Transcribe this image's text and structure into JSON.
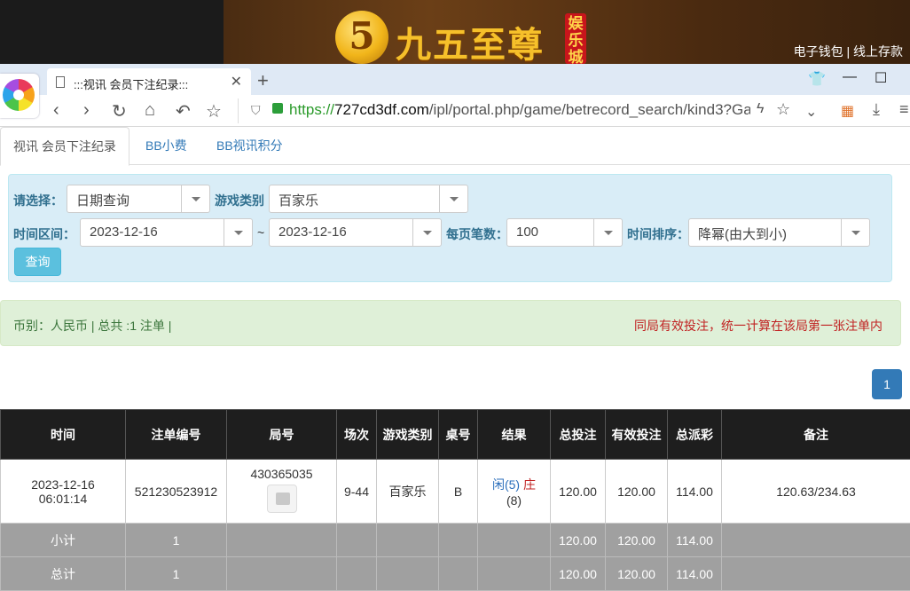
{
  "banner": {
    "logo_glyph": "5",
    "brand_name": "九五至尊",
    "brand_tag": "娱乐城",
    "links": "电子钱包 | 线上存款"
  },
  "browser": {
    "tab_title": ":::视讯 会员下注纪录:::",
    "url_scheme": "https://",
    "url_host": "727cd3df.com",
    "url_path": "/ipl/portal.php/game/betrecord_search/kind3?Ga"
  },
  "page_tabs": [
    {
      "label": "视讯 会员下注纪录",
      "active": true
    },
    {
      "label": "BB小费",
      "active": false
    },
    {
      "label": "BB视讯积分",
      "active": false
    }
  ],
  "filter": {
    "select_label": "请选择：",
    "select_value": "日期查询",
    "game_type_label": "游戏类别",
    "game_type_value": "百家乐",
    "range_label": "时间区间：",
    "date_from": "2023-12-16",
    "range_sep": "~",
    "date_to": "2023-12-16",
    "per_page_label": "每页笔数：",
    "per_page_value": "100",
    "sort_label": "时间排序：",
    "sort_value": "降幂(由大到小)",
    "query_button": "查询"
  },
  "summary": {
    "left": "币别：人民币 | 总共 :1 注单 |",
    "right": "同局有效投注，统一计算在该局第一张注单内"
  },
  "pagination": {
    "current": "1"
  },
  "table": {
    "headers": [
      "时间",
      "注单编号",
      "局号",
      "场次",
      "游戏类别",
      "桌号",
      "结果",
      "总投注",
      "有效投注",
      "总派彩",
      "备注"
    ],
    "row": {
      "date": "2023-12-16",
      "time": "06:01:14",
      "bet_no": "521230523912",
      "round_no": "430365035",
      "session": "9-44",
      "game": "百家乐",
      "table": "B",
      "result_player": "闲(5)",
      "result_banker": "庄",
      "result_banker_num": "(8)",
      "total_bet": "120.00",
      "valid_bet": "120.00",
      "payout": "114.00",
      "remark": "120.63/234.63"
    },
    "subtotal": {
      "label": "小计",
      "count": "1",
      "total_bet": "120.00",
      "valid_bet": "120.00",
      "payout": "114.00"
    },
    "grandtotal": {
      "label": "总计",
      "count": "1",
      "total_bet": "120.00",
      "valid_bet": "120.00",
      "payout": "114.00"
    }
  }
}
